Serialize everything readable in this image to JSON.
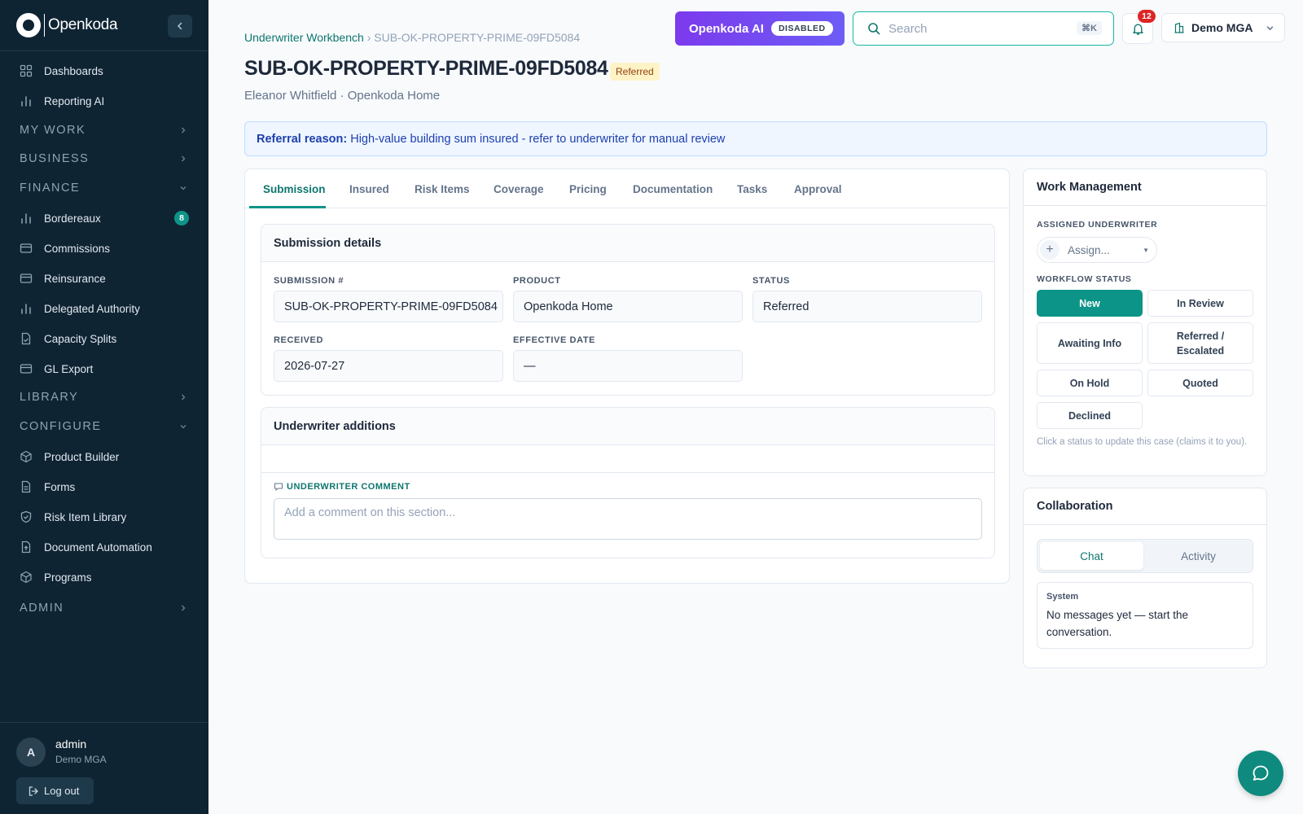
{
  "brand": {
    "name": "Openkoda"
  },
  "sidebar": {
    "items": [
      {
        "label": "Dashboards",
        "icon": "grid-icon"
      },
      {
        "label": "Reporting AI",
        "icon": "bar-chart-icon"
      },
      {
        "section": "MY WORK"
      },
      {
        "section": "BUSINESS"
      },
      {
        "section": "FINANCE"
      },
      {
        "label": "Bordereaux",
        "icon": "bar-chart-icon",
        "badge": "8"
      },
      {
        "label": "Commissions",
        "icon": "card-icon"
      },
      {
        "label": "Reinsurance",
        "icon": "card-icon"
      },
      {
        "label": "Delegated Authority",
        "icon": "bar-chart-icon"
      },
      {
        "label": "Capacity Splits",
        "icon": "file-check-icon"
      },
      {
        "label": "GL Export",
        "icon": "card-icon"
      },
      {
        "section": "LIBRARY"
      },
      {
        "section": "CONFIGURE"
      },
      {
        "label": "Product Builder",
        "icon": "cube-icon"
      },
      {
        "label": "Forms",
        "icon": "document-icon"
      },
      {
        "label": "Risk Item Library",
        "icon": "shield-check-icon"
      },
      {
        "label": "Document Automation",
        "icon": "file-upload-icon"
      },
      {
        "label": "Programs",
        "icon": "cube-icon"
      },
      {
        "section": "ADMIN"
      }
    ],
    "user": {
      "initial": "A",
      "name": "admin",
      "org": "Demo MGA"
    },
    "logout_label": "Log out"
  },
  "topbar": {
    "ai_label": "Openkoda AI",
    "ai_status": "DISABLED",
    "search_placeholder": "Search",
    "search_shortcut": "⌘K",
    "notification_count": "12",
    "org_name": "Demo MGA"
  },
  "header": {
    "breadcrumb_link": "Underwriter Workbench",
    "breadcrumb_sep": "›",
    "breadcrumb_current": "SUB-OK-PROPERTY-PRIME-09FD5084",
    "title": "SUB-OK-PROPERTY-PRIME-09FD5084",
    "status": "Referred",
    "subtitle": "Eleanor Whitfield · Openkoda Home"
  },
  "referral": {
    "label": "Referral reason:",
    "text": "High-value building sum insured - refer to underwriter for manual review"
  },
  "tabs": [
    "Submission",
    "Insured",
    "Risk Items",
    "Coverage",
    "Pricing",
    "Documentation",
    "Tasks",
    "Approval"
  ],
  "submission": {
    "title": "Submission details",
    "fields": {
      "submission_no": {
        "label": "SUBMISSION #",
        "value": "SUB-OK-PROPERTY-PRIME-09FD5084"
      },
      "product": {
        "label": "PRODUCT",
        "value": "Openkoda Home"
      },
      "status": {
        "label": "STATUS",
        "value": "Referred"
      },
      "received": {
        "label": "RECEIVED",
        "value": "2026-07-27"
      },
      "effective_date": {
        "label": "EFFECTIVE DATE",
        "value": "—"
      }
    }
  },
  "additions": {
    "title": "Underwriter additions",
    "comment_label": "UNDERWRITER COMMENT",
    "comment_placeholder": "Add a comment on this section..."
  },
  "work_management": {
    "title": "Work Management",
    "assigned_label": "ASSIGNED UNDERWRITER",
    "assign_placeholder": "Assign...",
    "workflow_label": "WORKFLOW STATUS",
    "statuses": [
      "New",
      "In Review",
      "Awaiting Info",
      "Referred / Escalated",
      "On Hold",
      "Quoted",
      "Declined"
    ],
    "active_status": "New",
    "help": "Click a status to update this case (claims it to you)."
  },
  "collaboration": {
    "title": "Collaboration",
    "tabs": [
      "Chat",
      "Activity"
    ],
    "message_from": "System",
    "message_text": "No messages yet — start the conversation."
  },
  "colors": {
    "sidebar_bg": "#0f2433",
    "accent": "#0d9488",
    "ai_purple": "#7c3aed",
    "badge_red": "#dc2626",
    "referred_bg": "#fef3c7"
  }
}
